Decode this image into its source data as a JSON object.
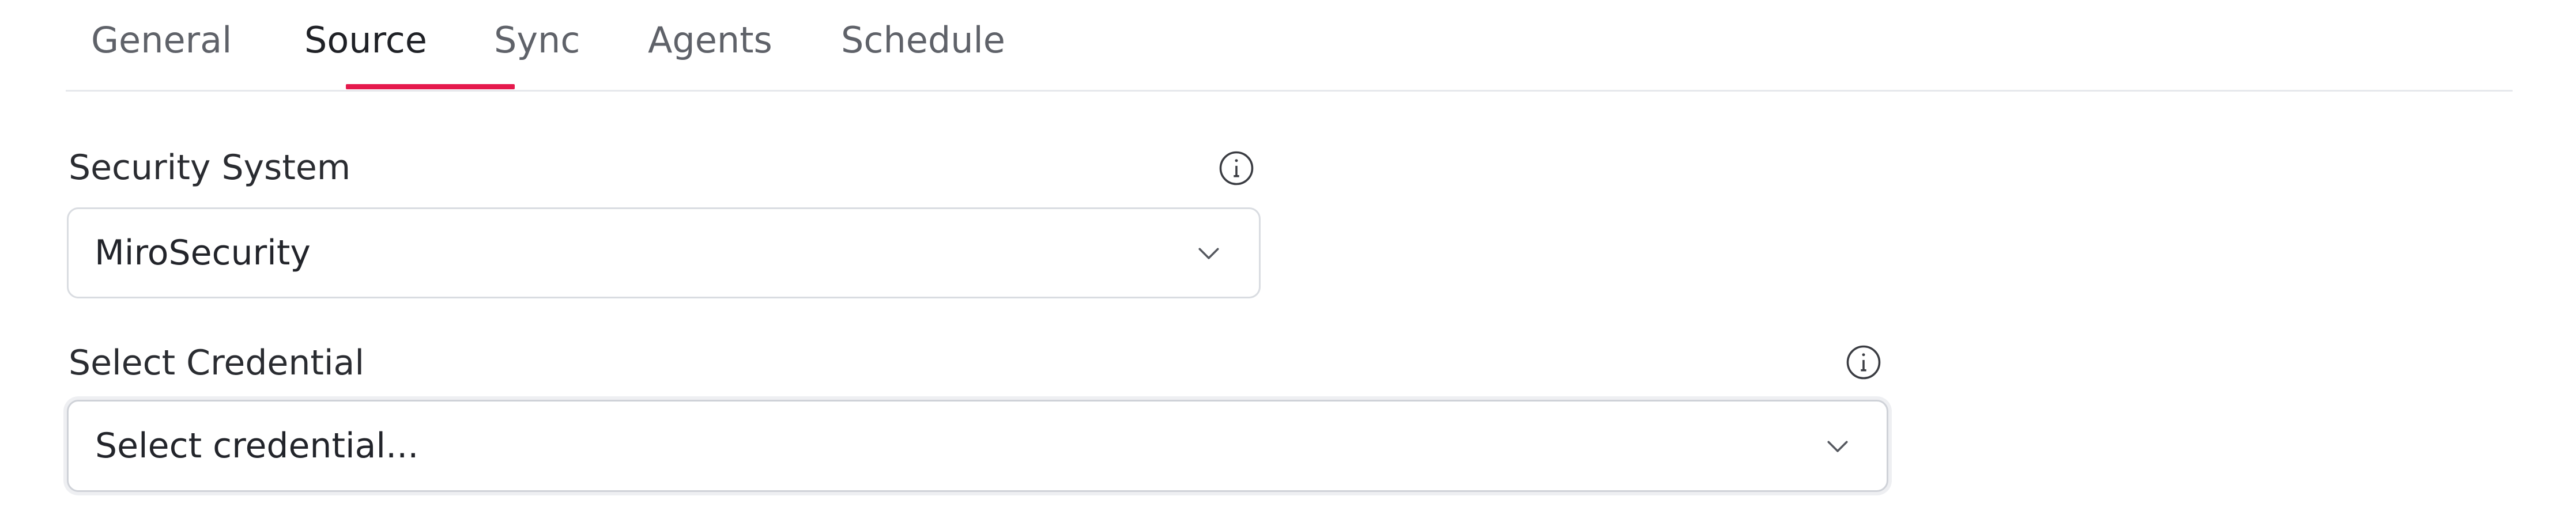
{
  "tabs": [
    {
      "label": "General"
    },
    {
      "label": "Source"
    },
    {
      "label": "Sync"
    },
    {
      "label": "Agents"
    },
    {
      "label": "Schedule"
    }
  ],
  "active_tab": "Source",
  "security_system": {
    "label": "Security System",
    "value": "MiroSecurity"
  },
  "credential": {
    "label": "Select Credential",
    "placeholder": "Select credential..."
  },
  "icons": {
    "info": "info-circle-icon",
    "chevron": "chevron-down-icon"
  },
  "colors": {
    "accent": "#e5194c",
    "border": "#d9dce1",
    "text": "#2b2d33",
    "muted": "#5f6269"
  }
}
